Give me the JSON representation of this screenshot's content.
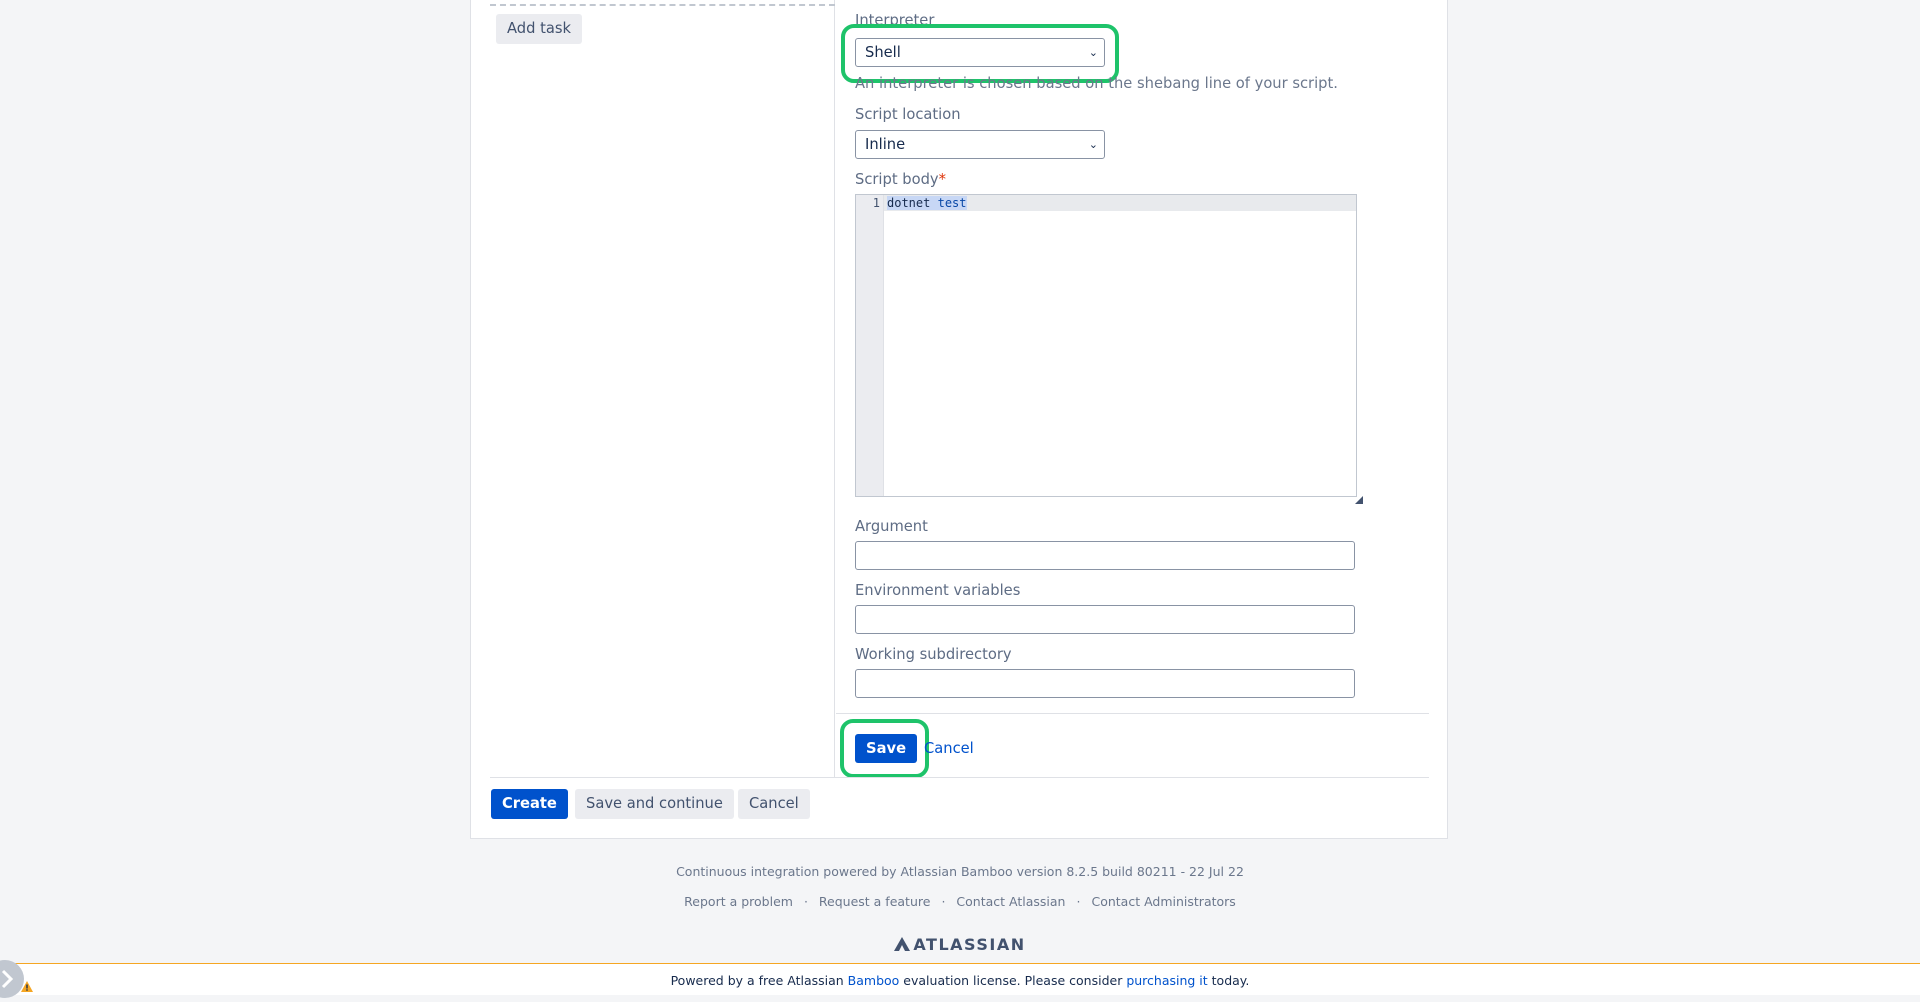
{
  "left_panel": {
    "add_task_label": "Add task"
  },
  "task_form": {
    "interpreter": {
      "label": "Interpreter",
      "selected": "Shell",
      "help": "An interpreter is chosen based on the shebang line of your script."
    },
    "script_location": {
      "label": "Script location",
      "selected": "Inline"
    },
    "script_body": {
      "label": "Script body",
      "required_marker": "*",
      "line_number": "1",
      "code_word1": "dotnet",
      "code_word2": "test"
    },
    "argument": {
      "label": "Argument",
      "value": ""
    },
    "environment_variables": {
      "label": "Environment variables",
      "value": ""
    },
    "working_subdirectory": {
      "label": "Working subdirectory",
      "value": ""
    },
    "save_label": "Save",
    "cancel_label": "Cancel"
  },
  "bottom_actions": {
    "create_label": "Create",
    "save_continue_label": "Save and continue",
    "cancel_label": "Cancel"
  },
  "footer": {
    "powered_by": "Continuous integration powered by Atlassian Bamboo version 8.2.5 build 80211 - 22 Jul 22",
    "links": [
      "Report a problem",
      "Request a feature",
      "Contact Atlassian",
      "Contact Administrators"
    ],
    "separator": "·",
    "brand": "ATLASSIAN"
  },
  "license_bar": {
    "prefix": "Powered by a free Atlassian ",
    "product_link": "Bamboo",
    "middle": " evaluation license. Please consider ",
    "purchase_link": "purchasing it",
    "suffix": " today."
  },
  "colors": {
    "primary": "#0052cc",
    "highlight": "#1ec36a",
    "license_border": "#f5a623"
  },
  "icons": [
    "chevron-down-icon",
    "atlassian-logo-icon",
    "chevron-right-icon",
    "warning-icon",
    "resize-handle-icon"
  ]
}
